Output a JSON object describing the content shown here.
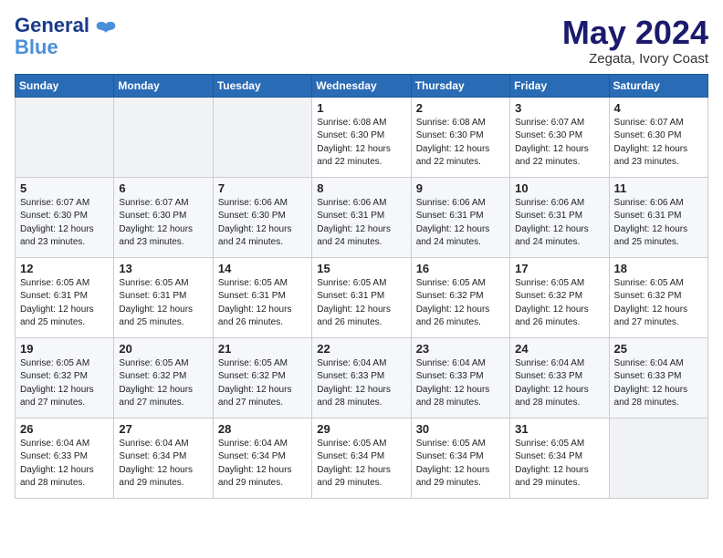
{
  "header": {
    "logo_line1": "General",
    "logo_line2": "Blue",
    "month": "May 2024",
    "location": "Zegata, Ivory Coast"
  },
  "days_of_week": [
    "Sunday",
    "Monday",
    "Tuesday",
    "Wednesday",
    "Thursday",
    "Friday",
    "Saturday"
  ],
  "weeks": [
    [
      {
        "day": "",
        "info": ""
      },
      {
        "day": "",
        "info": ""
      },
      {
        "day": "",
        "info": ""
      },
      {
        "day": "1",
        "info": "Sunrise: 6:08 AM\nSunset: 6:30 PM\nDaylight: 12 hours\nand 22 minutes."
      },
      {
        "day": "2",
        "info": "Sunrise: 6:08 AM\nSunset: 6:30 PM\nDaylight: 12 hours\nand 22 minutes."
      },
      {
        "day": "3",
        "info": "Sunrise: 6:07 AM\nSunset: 6:30 PM\nDaylight: 12 hours\nand 22 minutes."
      },
      {
        "day": "4",
        "info": "Sunrise: 6:07 AM\nSunset: 6:30 PM\nDaylight: 12 hours\nand 23 minutes."
      }
    ],
    [
      {
        "day": "5",
        "info": "Sunrise: 6:07 AM\nSunset: 6:30 PM\nDaylight: 12 hours\nand 23 minutes."
      },
      {
        "day": "6",
        "info": "Sunrise: 6:07 AM\nSunset: 6:30 PM\nDaylight: 12 hours\nand 23 minutes."
      },
      {
        "day": "7",
        "info": "Sunrise: 6:06 AM\nSunset: 6:30 PM\nDaylight: 12 hours\nand 24 minutes."
      },
      {
        "day": "8",
        "info": "Sunrise: 6:06 AM\nSunset: 6:31 PM\nDaylight: 12 hours\nand 24 minutes."
      },
      {
        "day": "9",
        "info": "Sunrise: 6:06 AM\nSunset: 6:31 PM\nDaylight: 12 hours\nand 24 minutes."
      },
      {
        "day": "10",
        "info": "Sunrise: 6:06 AM\nSunset: 6:31 PM\nDaylight: 12 hours\nand 24 minutes."
      },
      {
        "day": "11",
        "info": "Sunrise: 6:06 AM\nSunset: 6:31 PM\nDaylight: 12 hours\nand 25 minutes."
      }
    ],
    [
      {
        "day": "12",
        "info": "Sunrise: 6:05 AM\nSunset: 6:31 PM\nDaylight: 12 hours\nand 25 minutes."
      },
      {
        "day": "13",
        "info": "Sunrise: 6:05 AM\nSunset: 6:31 PM\nDaylight: 12 hours\nand 25 minutes."
      },
      {
        "day": "14",
        "info": "Sunrise: 6:05 AM\nSunset: 6:31 PM\nDaylight: 12 hours\nand 26 minutes."
      },
      {
        "day": "15",
        "info": "Sunrise: 6:05 AM\nSunset: 6:31 PM\nDaylight: 12 hours\nand 26 minutes."
      },
      {
        "day": "16",
        "info": "Sunrise: 6:05 AM\nSunset: 6:32 PM\nDaylight: 12 hours\nand 26 minutes."
      },
      {
        "day": "17",
        "info": "Sunrise: 6:05 AM\nSunset: 6:32 PM\nDaylight: 12 hours\nand 26 minutes."
      },
      {
        "day": "18",
        "info": "Sunrise: 6:05 AM\nSunset: 6:32 PM\nDaylight: 12 hours\nand 27 minutes."
      }
    ],
    [
      {
        "day": "19",
        "info": "Sunrise: 6:05 AM\nSunset: 6:32 PM\nDaylight: 12 hours\nand 27 minutes."
      },
      {
        "day": "20",
        "info": "Sunrise: 6:05 AM\nSunset: 6:32 PM\nDaylight: 12 hours\nand 27 minutes."
      },
      {
        "day": "21",
        "info": "Sunrise: 6:05 AM\nSunset: 6:32 PM\nDaylight: 12 hours\nand 27 minutes."
      },
      {
        "day": "22",
        "info": "Sunrise: 6:04 AM\nSunset: 6:33 PM\nDaylight: 12 hours\nand 28 minutes."
      },
      {
        "day": "23",
        "info": "Sunrise: 6:04 AM\nSunset: 6:33 PM\nDaylight: 12 hours\nand 28 minutes."
      },
      {
        "day": "24",
        "info": "Sunrise: 6:04 AM\nSunset: 6:33 PM\nDaylight: 12 hours\nand 28 minutes."
      },
      {
        "day": "25",
        "info": "Sunrise: 6:04 AM\nSunset: 6:33 PM\nDaylight: 12 hours\nand 28 minutes."
      }
    ],
    [
      {
        "day": "26",
        "info": "Sunrise: 6:04 AM\nSunset: 6:33 PM\nDaylight: 12 hours\nand 28 minutes."
      },
      {
        "day": "27",
        "info": "Sunrise: 6:04 AM\nSunset: 6:34 PM\nDaylight: 12 hours\nand 29 minutes."
      },
      {
        "day": "28",
        "info": "Sunrise: 6:04 AM\nSunset: 6:34 PM\nDaylight: 12 hours\nand 29 minutes."
      },
      {
        "day": "29",
        "info": "Sunrise: 6:05 AM\nSunset: 6:34 PM\nDaylight: 12 hours\nand 29 minutes."
      },
      {
        "day": "30",
        "info": "Sunrise: 6:05 AM\nSunset: 6:34 PM\nDaylight: 12 hours\nand 29 minutes."
      },
      {
        "day": "31",
        "info": "Sunrise: 6:05 AM\nSunset: 6:34 PM\nDaylight: 12 hours\nand 29 minutes."
      },
      {
        "day": "",
        "info": ""
      }
    ]
  ]
}
